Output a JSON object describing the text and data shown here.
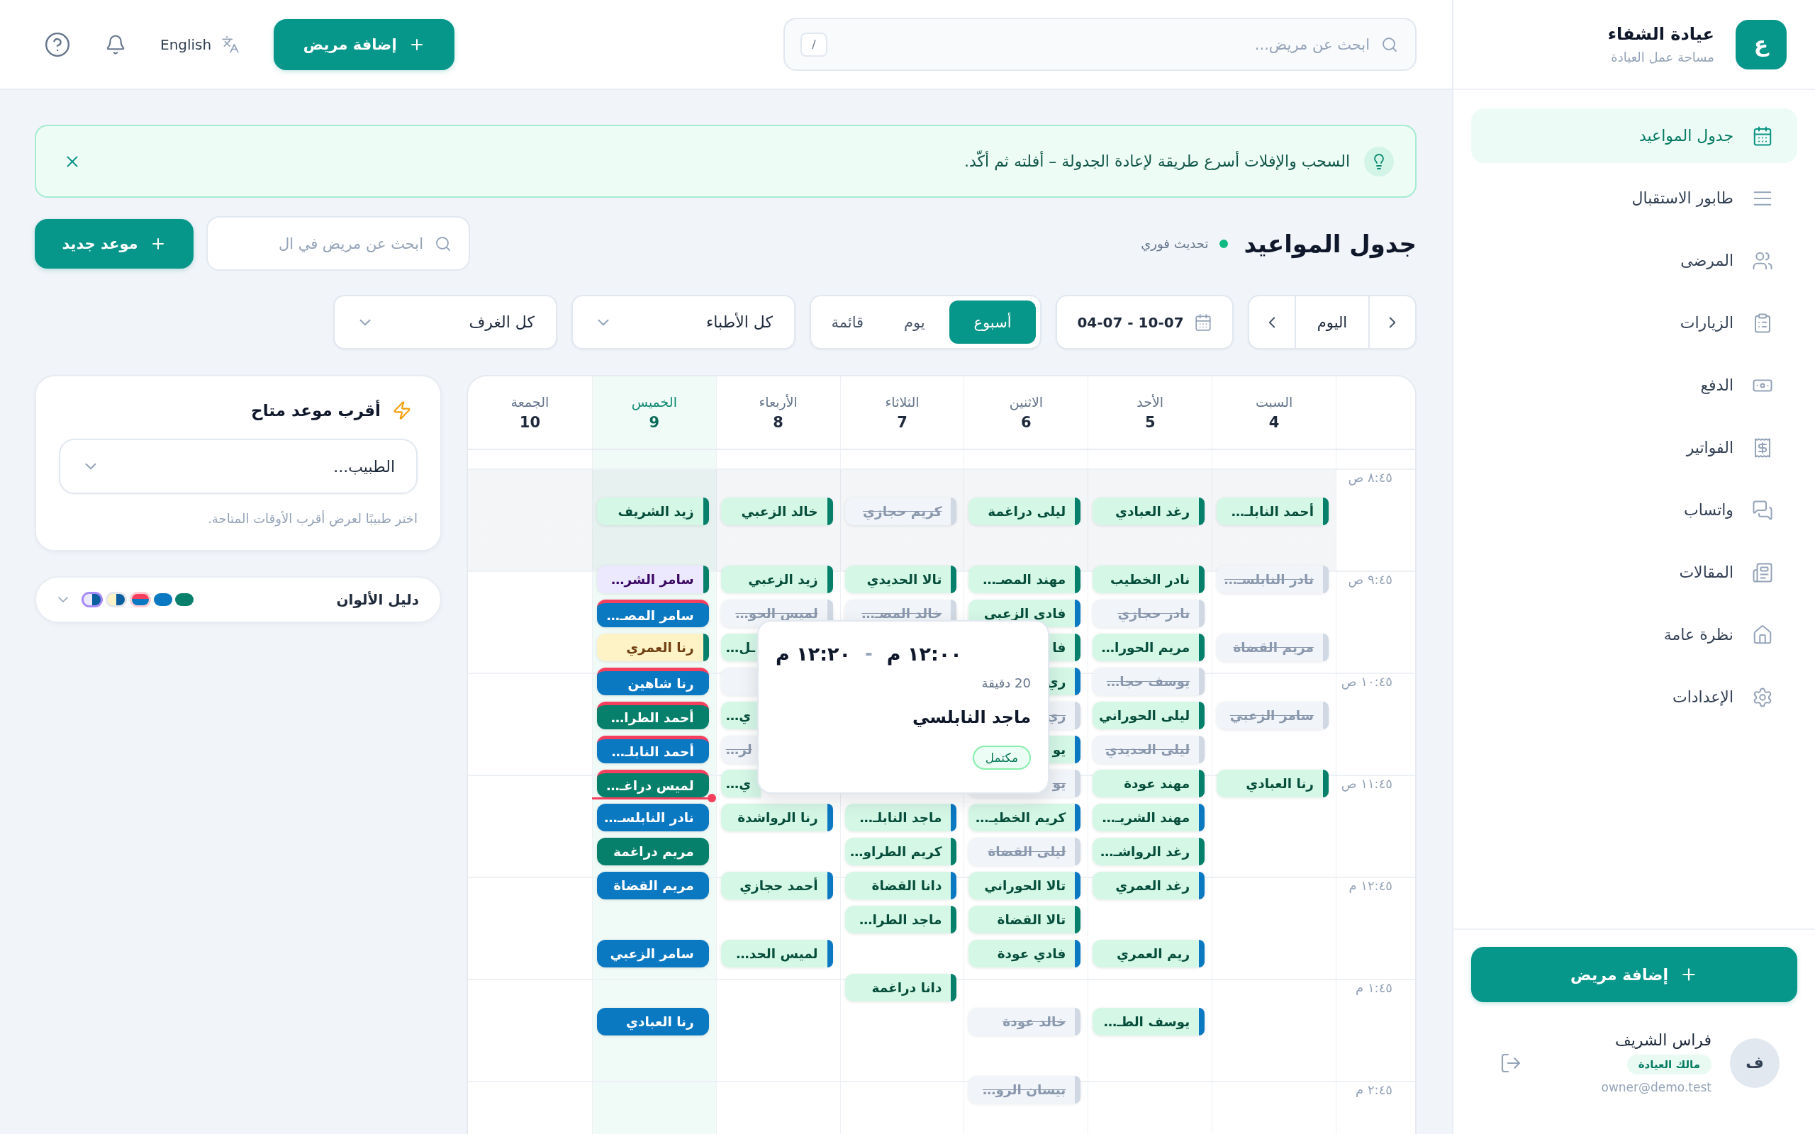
{
  "sidebar": {
    "logo_letter": "ع",
    "clinic_name": "عيادة الشفاء",
    "workspace_label": "مساحة عمل العيادة",
    "nav": [
      {
        "label": "جدول المواعيد",
        "selected": true
      },
      {
        "label": "طابور الاستقبال",
        "selected": false
      },
      {
        "label": "المرضى",
        "selected": false
      },
      {
        "label": "الزيارات",
        "selected": false
      },
      {
        "label": "الدفع",
        "selected": false
      },
      {
        "label": "الفواتير",
        "selected": false
      },
      {
        "label": "واتساب",
        "selected": false
      },
      {
        "label": "المقالات",
        "selected": false
      },
      {
        "label": "نظرة عامة",
        "selected": false
      },
      {
        "label": "الإعدادات",
        "selected": false
      }
    ],
    "add_patient_button": "إضافة مريض",
    "user": {
      "avatar_letter": "ف",
      "name": "فراس الشريف",
      "role": "مالك العيادة",
      "email": "owner@demo.test"
    }
  },
  "topbar": {
    "search": {
      "placeholder": "ابحث عن مريض...",
      "shortcut": "/"
    },
    "add_patient_button": "إضافة مريض",
    "language_button": "English"
  },
  "tip_banner": {
    "text": "السحب والإفلات أسرع طريقة لإعادة الجدولة – أفلته ثم أكّد."
  },
  "page_header": {
    "title": "جدول المواعيد",
    "live_label": "تحديث فوري",
    "search": {
      "placeholder": "ابحث عن مريض في ال"
    },
    "new_appointment_button": "موعد جديد"
  },
  "toolbar": {
    "today_button": "اليوم",
    "date_range": "04-07 - 10-07",
    "views": [
      {
        "label": "أسبوع",
        "selected": true
      },
      {
        "label": "يوم",
        "selected": false
      },
      {
        "label": "قائمة",
        "selected": false
      }
    ],
    "doctor_filter": "كل الأطباء",
    "room_filter": "كل الغرف"
  },
  "nearest_slot": {
    "title": "أقرب موعد متاح",
    "doctor_select": "الطبيب...",
    "hint": "اختر طبيبًا لعرض أقرب الأوقات المتاحة."
  },
  "legend": {
    "title": "دليل الألوان",
    "swatches": [
      {
        "kind": "doctor",
        "color": "#06806b"
      },
      {
        "kind": "doctor",
        "color": "#0b78c2"
      },
      {
        "kind": "late"
      },
      {
        "kind": "waiting"
      },
      {
        "kind": "in_progress"
      }
    ]
  },
  "calendar": {
    "days": [
      {
        "name": "السبت",
        "date": "4",
        "today": false,
        "slots": [
          {
            "name": "أحمد النابلـ…",
            "kind": "completed",
            "color": "#06806b"
          },
          {
            "kind": "free"
          },
          {
            "name": "نادر النابلسـ…",
            "kind": "cancelled"
          },
          {
            "kind": "free"
          },
          {
            "name": "مريم القضاة",
            "kind": "cancelled"
          },
          {
            "kind": "free"
          },
          {
            "name": "سامر الزعبي",
            "kind": "cancelled"
          },
          {
            "kind": "free"
          },
          {
            "name": "رنا العبادي",
            "kind": "completed",
            "color": "#06806b"
          }
        ]
      },
      {
        "name": "الأحد",
        "date": "5",
        "today": false,
        "slots": [
          {
            "name": "رغد العبادي",
            "kind": "completed",
            "color": "#06806b"
          },
          {
            "kind": "free"
          },
          {
            "name": "نادر الخطيب",
            "kind": "completed",
            "color": "#06806b"
          },
          {
            "name": "نادر حجازي",
            "kind": "cancelled"
          },
          {
            "name": "مريم الحورا…",
            "kind": "completed",
            "color": "#06806b"
          },
          {
            "name": "يوسف حجا…",
            "kind": "cancelled"
          },
          {
            "name": "ليلى الحوراني",
            "kind": "completed",
            "color": "#06806b"
          },
          {
            "name": "ليلى الحديدي",
            "kind": "cancelled"
          },
          {
            "name": "مهند عودة",
            "kind": "completed",
            "color": "#06806b"
          },
          {
            "name": "مهند الشريـ…",
            "kind": "completed",
            "color": "#0b78c2"
          },
          {
            "name": "رغد الرواشـ…",
            "kind": "completed",
            "color": "#06806b"
          },
          {
            "name": "رغد العمري",
            "kind": "completed",
            "color": "#0b78c2"
          },
          {
            "kind": "free"
          },
          {
            "name": "ريم العمري",
            "kind": "completed",
            "color": "#0b78c2"
          },
          {
            "kind": "free"
          },
          {
            "name": "يوسف الطـ…",
            "kind": "completed",
            "color": "#0b78c2"
          }
        ]
      },
      {
        "name": "الاثنين",
        "date": "6",
        "today": false,
        "slots": [
          {
            "name": "ليلى دراغمة",
            "kind": "completed",
            "color": "#06806b"
          },
          {
            "kind": "free"
          },
          {
            "name": "مهند المصـ…",
            "kind": "completed",
            "color": "#06806b"
          },
          {
            "name": "فادى الزعبى",
            "kind": "completed",
            "color": "#0b78c2"
          },
          {
            "name": "فا",
            "kind": "completed",
            "color": "#06806b"
          },
          {
            "name": "ري",
            "kind": "completed",
            "color": "#0b78c2"
          },
          {
            "name": "ري",
            "kind": "cancelled"
          },
          {
            "name": "يو",
            "kind": "completed",
            "color": "#0b78c2"
          },
          {
            "name": "يو",
            "kind": "cancelled"
          },
          {
            "name": "كريم الخطيـ…",
            "kind": "completed",
            "color": "#0b78c2"
          },
          {
            "name": "ليلى القضاة",
            "kind": "cancelled"
          },
          {
            "name": "تالا الحوراني",
            "kind": "completed",
            "color": "#0b78c2"
          },
          {
            "name": "تالا القضاة",
            "kind": "completed",
            "color": "#06806b"
          },
          {
            "name": "فادي عودة",
            "kind": "completed",
            "color": "#0b78c2"
          },
          {
            "kind": "free"
          },
          {
            "name": "خالد عودة",
            "kind": "cancelled"
          },
          {
            "kind": "free"
          },
          {
            "name": "بيسان الرو…",
            "kind": "cancelled"
          }
        ]
      },
      {
        "name": "الثلاثاء",
        "date": "7",
        "today": false,
        "slots": [
          {
            "name": "كريم حجازي",
            "kind": "cancelled"
          },
          {
            "kind": "free"
          },
          {
            "name": "تالا الحديدي",
            "kind": "completed",
            "color": "#06806b"
          },
          {
            "name": "خالد المصـ…",
            "kind": "cancelled"
          },
          {
            "kind": "free"
          },
          {
            "kind": "free"
          },
          {
            "kind": "free"
          },
          {
            "kind": "free"
          },
          {
            "kind": "free"
          },
          {
            "name": "ماجد النابلـ…",
            "kind": "completed",
            "color": "#0b78c2"
          },
          {
            "name": "كريم الطراو…",
            "kind": "completed",
            "color": "#06806b"
          },
          {
            "name": "دانا القضاة",
            "kind": "completed",
            "color": "#0b78c2"
          },
          {
            "name": "ماجد الطرا…",
            "kind": "completed",
            "color": "#06806b"
          },
          {
            "kind": "free"
          },
          {
            "name": "دانا دراغمة",
            "kind": "completed",
            "color": "#06806b"
          }
        ]
      },
      {
        "name": "الأربعاء",
        "date": "8",
        "today": false,
        "slots": [
          {
            "name": "خالد الزعبي",
            "kind": "completed",
            "color": "#06806b"
          },
          {
            "kind": "free"
          },
          {
            "name": "زيد الزعبي",
            "kind": "completed",
            "color": "#06806b"
          },
          {
            "name": "لميس الحو…",
            "kind": "cancelled"
          },
          {
            "name": "ـل…",
            "kind": "completed",
            "start_hidden": true
          },
          {
            "kind": "cancelled"
          },
          {
            "name": "ي…",
            "kind": "completed",
            "start_hidden": true
          },
          {
            "name": "لر…",
            "kind": "cancelled",
            "start_hidden": true
          },
          {
            "name": "ي…",
            "kind": "completed",
            "start_hidden": true
          },
          {
            "name": "رنا الرواشدة",
            "kind": "completed",
            "color": "#0b78c2"
          },
          {
            "kind": "free"
          },
          {
            "name": "أحمد حجازي",
            "kind": "completed",
            "color": "#0b78c2"
          },
          {
            "kind": "free"
          },
          {
            "name": "لميس الحد…",
            "kind": "completed",
            "color": "#0b78c2"
          }
        ]
      },
      {
        "name": "الخميس",
        "date": "9",
        "today": true,
        "slots": [
          {
            "name": "زيد الشريف",
            "kind": "completed",
            "color": "#06806b"
          },
          {
            "kind": "free"
          },
          {
            "name": "سامر الشر…",
            "kind": "in_progress",
            "color": "#06806b"
          },
          {
            "name": "سامر المصـ…",
            "kind": "late",
            "color": "#0b78c2"
          },
          {
            "name": "رنا العمري",
            "kind": "waiting",
            "color": "#06806b"
          },
          {
            "name": "رنا شاهين",
            "kind": "late",
            "color": "#0b78c2"
          },
          {
            "name": "أحمد الطرا…",
            "kind": "late",
            "color": "#06806b"
          },
          {
            "name": "أحمد النابلـ…",
            "kind": "late",
            "color": "#0b78c2"
          },
          {
            "name": "لميس دراغـ…",
            "kind": "late",
            "color": "#06806b"
          },
          {
            "name": "نادر النابلسـ…",
            "kind": "scheduled",
            "color": "#0b78c2"
          },
          {
            "name": "مريم دراغمة",
            "kind": "scheduled",
            "color": "#06806b"
          },
          {
            "name": "مريم القضاة",
            "kind": "scheduled",
            "color": "#0b78c2"
          },
          {
            "kind": "free"
          },
          {
            "name": "سامر الزعبي",
            "kind": "scheduled",
            "color": "#0b78c2"
          },
          {
            "kind": "free"
          },
          {
            "name": "رنا العبادي",
            "kind": "scheduled",
            "color": "#0b78c2"
          }
        ]
      },
      {
        "name": "الجمعة",
        "date": "10",
        "today": false
      }
    ],
    "hours": [
      {
        "label": "٨:٤٥ ص",
        "shaded": true
      },
      {
        "label": "٩:٤٥ ص",
        "shaded": false
      },
      {
        "label": "١٠:٤٥ ص",
        "shaded": false
      },
      {
        "label": "١١:٤٥ ص",
        "shaded": false
      },
      {
        "label": "١٢:٤٥ م",
        "shaded": false
      },
      {
        "label": "١:٤٥ م",
        "shaded": false
      },
      {
        "label": "٢:٤٥ م",
        "shaded": false
      }
    ],
    "popover": {
      "start": "١٢:٠٠ م",
      "separator": "-",
      "end": "١٢:٢٠ م",
      "duration": "20 دقيقة",
      "patient": "ماجد النابلسي",
      "status": "مكتمل"
    }
  }
}
